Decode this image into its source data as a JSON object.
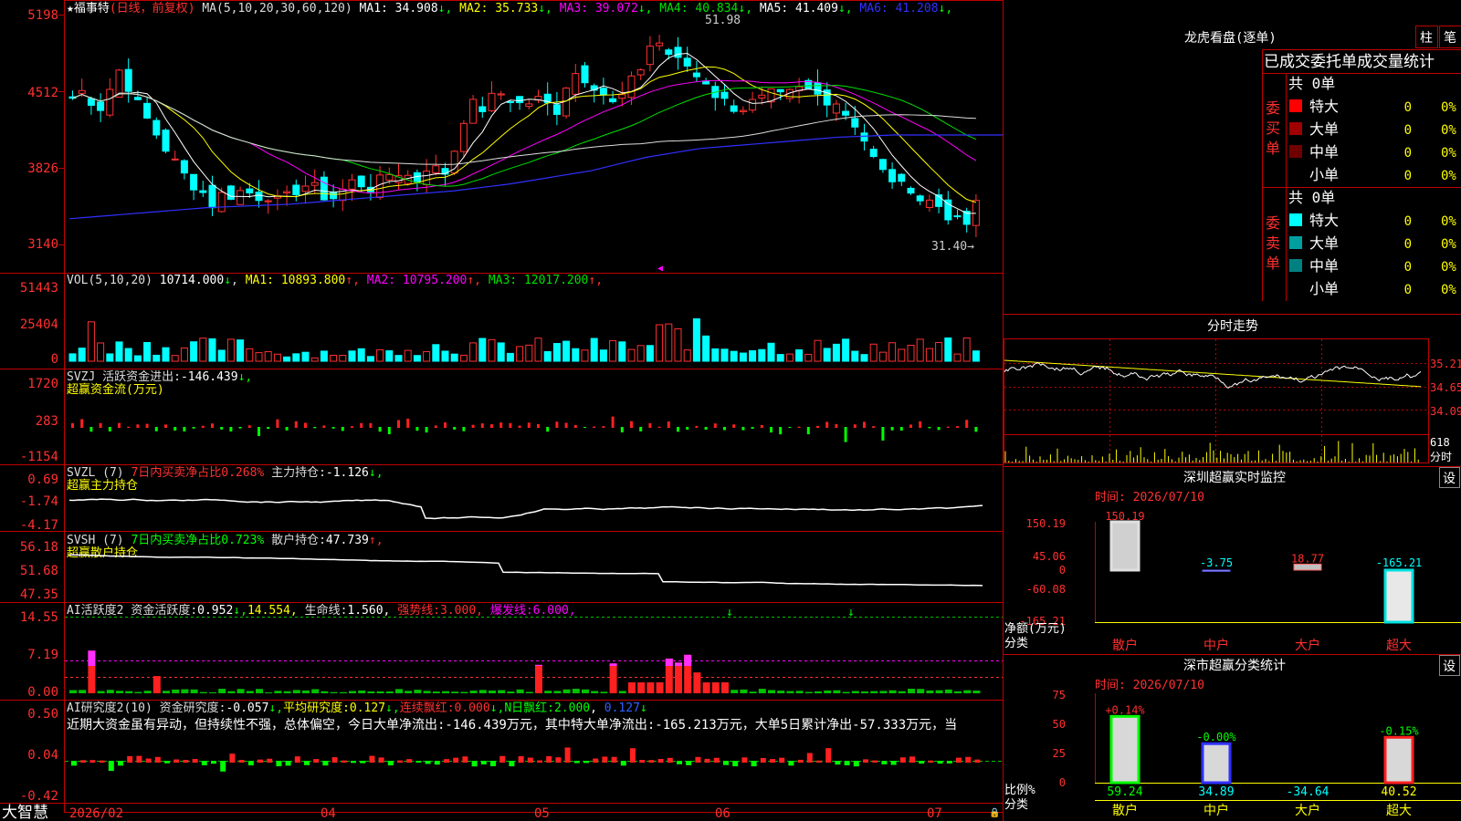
{
  "stock": {
    "name": "福事特",
    "period_label": "日线，前复权",
    "ma_line": "MA(5,10,20,30,60,120)",
    "ma_values": [
      {
        "label": "MA1:",
        "value": "34.908",
        "arrow": "↓",
        "color": "#ffffff"
      },
      {
        "label": "MA2:",
        "value": "35.733",
        "arrow": "↓",
        "color": "#ffff00"
      },
      {
        "label": "MA3:",
        "value": "39.072",
        "arrow": "↓",
        "color": "#ff00ff"
      },
      {
        "label": "MA4:",
        "value": "40.834",
        "arrow": "↓",
        "color": "#00e000"
      },
      {
        "label": "MA5:",
        "value": "41.409",
        "arrow": "↓",
        "color": "#ffffff"
      },
      {
        "label": "MA6:",
        "value": "41.208",
        "arrow": "↓",
        "color": "#3030ff"
      }
    ],
    "high_label": "51.98",
    "low_label": "31.40→",
    "price_ticks": [
      "5198",
      "4512",
      "3826",
      "3140"
    ]
  },
  "vol": {
    "header": "VOL(5,10,20)",
    "value": "10714.000",
    "arrow": "↓",
    "ma": [
      {
        "label": "MA1:",
        "value": "10893.800",
        "arrow": "↑",
        "color": "#ffff00"
      },
      {
        "label": "MA2:",
        "value": "10795.200",
        "arrow": "↑",
        "color": "#ff00ff"
      },
      {
        "label": "MA3:",
        "value": "12017.200",
        "arrow": "↑",
        "color": "#00e000"
      }
    ],
    "ticks": [
      "51443",
      "25404",
      "0"
    ]
  },
  "svzj": {
    "header": "SVZJ  活跃资金进出:",
    "value": "-146.439",
    "arrow": "↓,",
    "sub": "超赢资金流(万元)",
    "ticks": [
      "1720",
      "283",
      "-1154"
    ]
  },
  "svzl": {
    "header": "SVZL (7)",
    "ratio": "7日内买卖净占比0.268%",
    "hold": "主力持仓:",
    "hold_value": "-1.126",
    "arrow": "↓,",
    "sub": "超赢主力持仓",
    "ticks": [
      "0.69",
      "-1.74",
      "-4.17"
    ]
  },
  "svsh": {
    "header": "SVSH (7)",
    "ratio": "7日内买卖净占比0.723%",
    "hold": "散户持仓:",
    "hold_value": "47.739",
    "arrow": "↑,",
    "sub": "超赢散户持仓",
    "ticks": [
      "56.18",
      "51.68",
      "47.35"
    ]
  },
  "ai1": {
    "header": "AI活跃度2",
    "label1": "资金活跃度:",
    "v1": "0.952",
    "v2": "14.554",
    "label3": "生命线:",
    "v3": "1.560",
    "label4": "强势线:",
    "v4": "3.000",
    "label5": "爆发线:",
    "v5": "6.000",
    "ticks": [
      "14.55",
      "7.19",
      "0.00"
    ]
  },
  "ai2": {
    "header": "AI研究度2(10)",
    "label1": "资金研究度:",
    "v1": "-0.057",
    "label2": "平均研究度:",
    "v2": "0.127",
    "label3": "连续飘红:",
    "v3": "0.000",
    "label4": "N日飘红:",
    "v4": "2.000",
    "v5": "0.127",
    "comment": "近期大资金虽有异动，但持续性不强，总体偏空，今日大单净流出:-146.439万元，其中特大单净流出:-165.213万元，大单5日累计净出-57.333万元，当",
    "ticks": [
      "0.50",
      "0.04",
      "-0.42"
    ]
  },
  "xaxis": {
    "brand": "大智慧",
    "labels": [
      "2026/02",
      "04",
      "05",
      "06",
      "07"
    ]
  },
  "lhb": {
    "title": "龙虎看盘(逐单)",
    "btn1": "柱",
    "btn2": "笔",
    "tabs": "已成交委托单成交量统计",
    "buy_label": "委买单",
    "sell_label": "委卖单",
    "buy_total": "共 0单",
    "sell_total": "共 0单",
    "buy_rows": [
      {
        "name": "特大",
        "count": "0",
        "pct": "0%",
        "color": "#ff0000"
      },
      {
        "name": "大单",
        "count": "0",
        "pct": "0%",
        "color": "#a00000"
      },
      {
        "name": "中单",
        "count": "0",
        "pct": "0%",
        "color": "#700000"
      },
      {
        "name": "小单",
        "count": "0",
        "pct": "0%",
        "color": ""
      }
    ],
    "sell_rows": [
      {
        "name": "特大",
        "count": "0",
        "pct": "0%",
        "color": "#00ffff"
      },
      {
        "name": "大单",
        "count": "0",
        "pct": "0%",
        "color": "#00a0a0"
      },
      {
        "name": "中单",
        "count": "0",
        "pct": "0%",
        "color": "#008080"
      },
      {
        "name": "小单",
        "count": "0",
        "pct": "0%",
        "color": ""
      }
    ]
  },
  "intraday": {
    "title": "分时走势",
    "ticks": [
      "35.21",
      "34.65",
      "34.09"
    ],
    "vol_label": "618",
    "vol_unit": "分时"
  },
  "sz_monitor": {
    "title": "深圳超赢实时监控",
    "set_btn": "设",
    "time": "时间: 2026/07/10",
    "ticks": [
      "150.19",
      "45.06",
      "0",
      "-60.08",
      "-165.21"
    ],
    "ylabel1": "净额(万元)",
    "ylabel2": "分类"
  },
  "sz_stats": {
    "title": "深市超赢分类统计",
    "set_btn": "设",
    "time": "时间: 2026/07/10",
    "ticks": [
      "75",
      "50",
      "25",
      "0"
    ],
    "ylabel1": "比例%",
    "ylabel2": "分类"
  },
  "chart_data": [
    {
      "type": "bar",
      "title": "深圳超赢实时监控",
      "ylabel": "净额(万元)",
      "xlabel": "分类",
      "categories": [
        "散户",
        "中户",
        "大户",
        "超大"
      ],
      "values": [
        150.19,
        -3.75,
        18.77,
        -165.21
      ],
      "value_labels": [
        "150.19",
        "-3.75",
        "18.77",
        "-165.21"
      ],
      "ylim": [
        -165.21,
        150.19
      ]
    },
    {
      "type": "bar",
      "title": "深市超赢分类统计",
      "ylabel": "比例%",
      "xlabel": "分类",
      "categories": [
        "散户",
        "中户",
        "大户",
        "超大"
      ],
      "values": [
        59.24,
        34.89,
        -34.64,
        40.52
      ],
      "top_labels": [
        "+0.14%",
        "-0.00%",
        "",
        "-0.15%"
      ],
      "bottom_labels": [
        "59.24",
        "34.89",
        "-34.64",
        "40.52"
      ],
      "ylim": [
        0,
        75
      ]
    },
    {
      "type": "line",
      "title": "",
      "series": [
        {
          "name": "MA1",
          "values": [
            42.5,
            43.0,
            42.0,
            41.0,
            39.5,
            38.0,
            37.5,
            37.2,
            37.0,
            36.8,
            36.6,
            37.0,
            37.8,
            39.0,
            40.5,
            41.5,
            42.2,
            42.8,
            43.0,
            44.0,
            46.5,
            48.5,
            47.0,
            46.0,
            45.0,
            44.5,
            44.2,
            44.0,
            43.5,
            42.5,
            40.0,
            37.5,
            36.5,
            35.5,
            34.9
          ]
        },
        {
          "name": "MA6",
          "values": [
            33.7,
            33.9,
            34.1,
            34.3,
            34.5,
            34.7,
            34.8,
            34.9,
            35.0,
            35.2,
            35.4,
            35.6,
            35.8,
            36.0,
            36.2,
            36.5,
            36.8,
            37.2,
            37.6,
            38.0,
            38.6,
            39.2,
            39.6,
            40.0,
            40.2,
            40.4,
            40.6,
            40.8,
            41.0,
            41.1,
            41.2,
            41.2,
            41.2,
            41.2,
            41.2
          ]
        }
      ],
      "xlabel": "",
      "ylabel": "",
      "ylim": [
        31.4,
        51.98
      ]
    }
  ]
}
